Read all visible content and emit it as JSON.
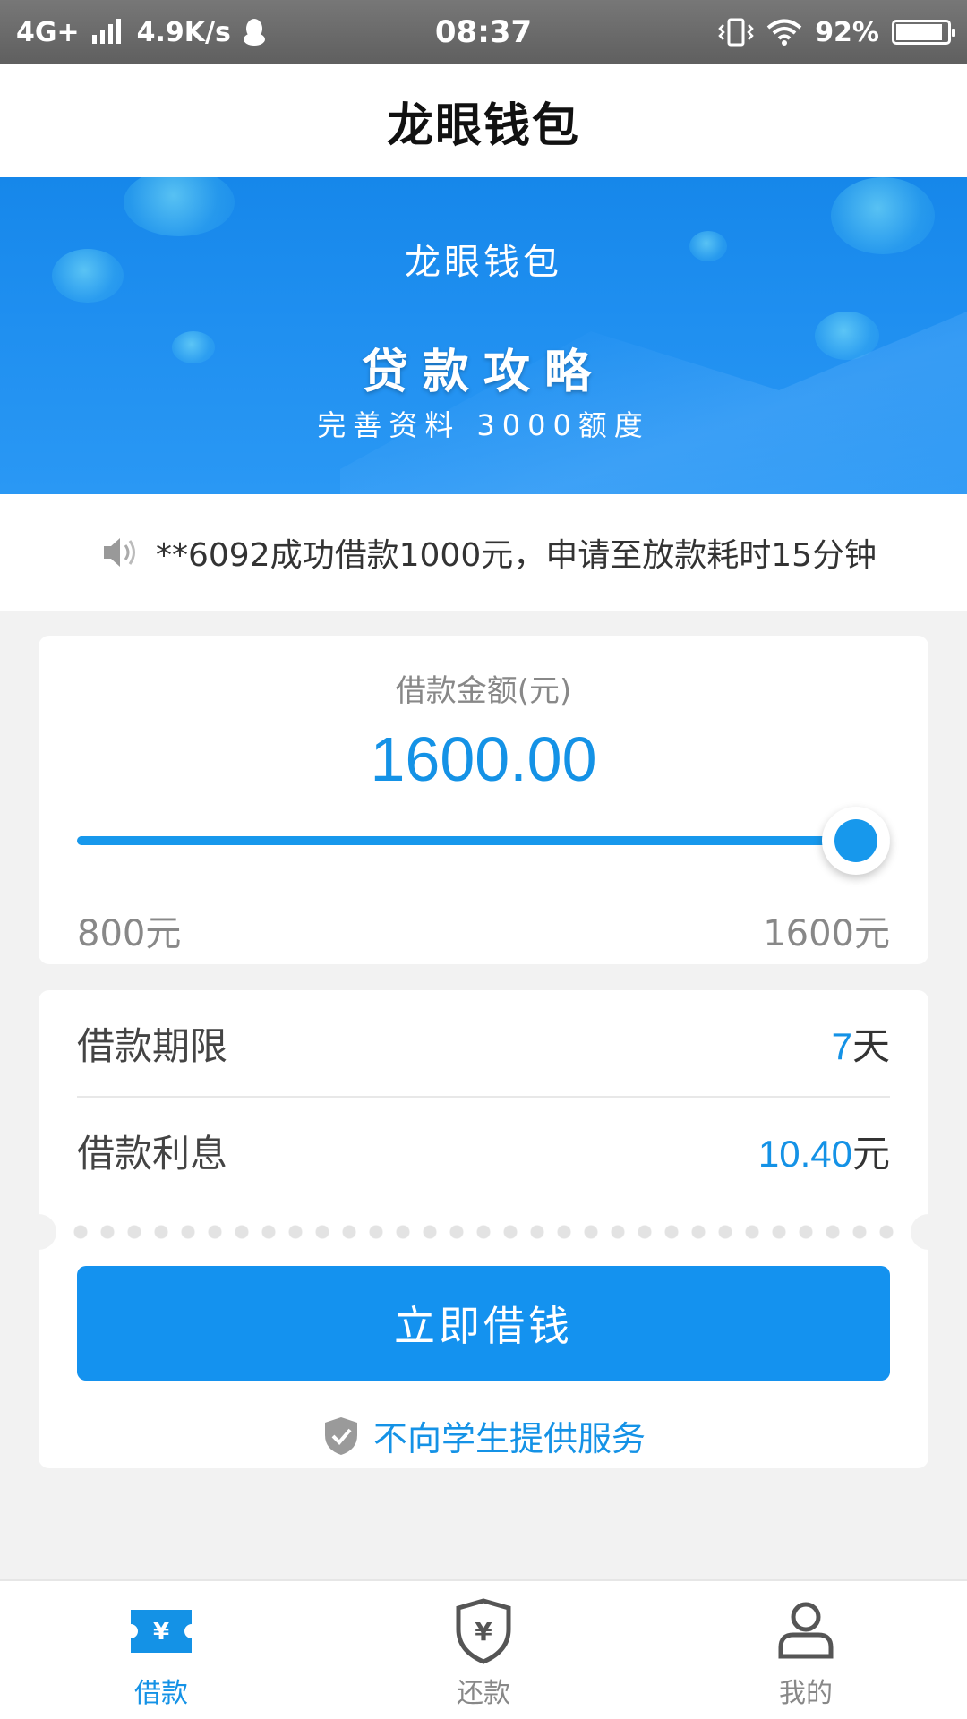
{
  "status_bar": {
    "network": "4G+",
    "speed": "4.9K/s",
    "time": "08:37",
    "battery": "92%",
    "battery_level": 0.92
  },
  "app": {
    "title": "龙眼钱包"
  },
  "banner": {
    "brand": "龙眼钱包",
    "headline": "贷款攻略",
    "subtitle": "完善资料 3000额度"
  },
  "notice": {
    "text": "**6092成功借款1000元，申请至放款耗时15分钟",
    "icon": "speaker-icon"
  },
  "loan": {
    "amount_label": "借款金额(元)",
    "amount_value": "1600.00",
    "slider": {
      "min": 800,
      "max": 1600,
      "value": 1600,
      "min_label": "800元",
      "max_label": "1600元"
    },
    "term_label": "借款期限",
    "term_value": "7",
    "term_unit": "天",
    "interest_label": "借款利息",
    "interest_value": "10.40",
    "interest_unit": "元",
    "submit_label": "立即借钱",
    "student_notice": "不向学生提供服务"
  },
  "bottom_nav": {
    "items": [
      {
        "label": "借款",
        "icon": "ticket-yen-icon",
        "active": true
      },
      {
        "label": "还款",
        "icon": "shield-yen-icon",
        "active": false
      },
      {
        "label": "我的",
        "icon": "person-icon",
        "active": false
      }
    ]
  },
  "colors": {
    "accent": "#1492e6",
    "banner": "#1f8ff0",
    "inactive": "#888888"
  }
}
